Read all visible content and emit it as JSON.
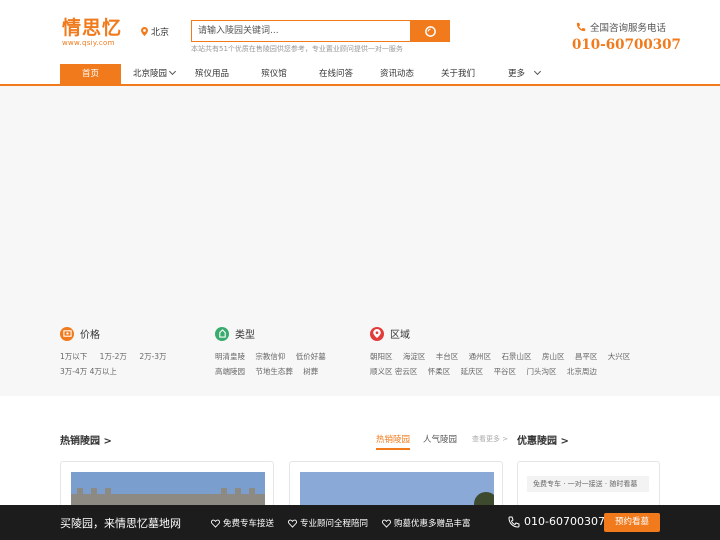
{
  "brand": {
    "name": "情思忆",
    "domain": "www.qsiy.com",
    "accent": "#f07a1c"
  },
  "location": {
    "city": "北京",
    "icon": "location-pin-icon"
  },
  "search": {
    "placeholder": "请输入陵园关键词...",
    "note": "本站共有51个优质在售陵园供您参考，专业置业顾问提供一对一服务"
  },
  "hotline": {
    "label": "全国咨询服务电话",
    "number": "010-60700307"
  },
  "nav": {
    "items": [
      {
        "label": "首页",
        "active": true
      },
      {
        "label": "北京陵园",
        "dropdown": true
      },
      {
        "label": "殡仪用品"
      },
      {
        "label": "殡仪馆"
      },
      {
        "label": "在线问答"
      },
      {
        "label": "资讯动态"
      },
      {
        "label": "关于我们"
      },
      {
        "label": "更多",
        "dropdown": true
      }
    ]
  },
  "filters": {
    "price": {
      "title": "价格",
      "options": [
        "1万以下",
        "1万-2万",
        "2万-3万",
        "3万-4万",
        "4万以上"
      ]
    },
    "type": {
      "title": "类型",
      "options": [
        "明清皇陵",
        "宗教信仰",
        "低价好墓",
        "高端陵园",
        "节地生态葬",
        "树葬"
      ]
    },
    "region": {
      "title": "区域",
      "options": [
        "朝阳区",
        "海淀区",
        "丰台区",
        "通州区",
        "石景山区",
        "房山区",
        "昌平区",
        "大兴区",
        "顺义区",
        "密云区",
        "怀柔区",
        "延庆区",
        "平谷区",
        "门头沟区",
        "北京周边"
      ]
    }
  },
  "hot_section": {
    "title": "热销陵园 >",
    "tabs": [
      "热销陵园",
      "人气陵园"
    ],
    "more": "查看更多 >"
  },
  "promo_section": {
    "title": "优惠陵园 >",
    "chip": "免费专车 · 一对一接送 · 随时看墓"
  },
  "bottom_bar": {
    "slogan": "买陵园，来情思忆墓地网",
    "features": [
      "免费专车接送",
      "专业顾问全程陪同",
      "购墓优惠多赠品丰富"
    ],
    "phone": "010-60700307",
    "button": "预约看墓"
  }
}
